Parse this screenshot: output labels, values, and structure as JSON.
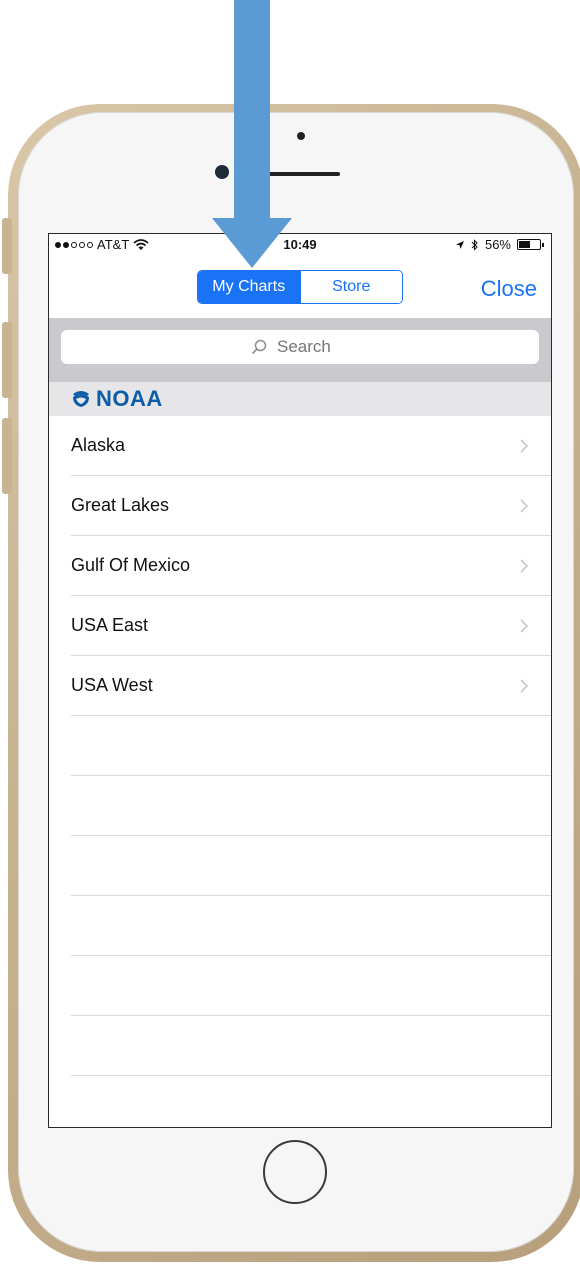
{
  "status_bar": {
    "carrier": "AT&T",
    "time": "10:49",
    "battery_percent": "56%",
    "battery_level": 0.56
  },
  "nav": {
    "segments": [
      "My Charts",
      "Store"
    ],
    "selected_segment": "My Charts",
    "close_label": "Close"
  },
  "search": {
    "placeholder": "Search"
  },
  "section": {
    "title": "NOAA"
  },
  "chart_regions": [
    "Alaska",
    "Great Lakes",
    "Gulf Of Mexico",
    "USA East",
    "USA West"
  ],
  "colors": {
    "accent": "#1a73f5",
    "noaa": "#0d5ca8",
    "arrow": "#5b9bd5",
    "search_bar_bg": "#c9c9ce",
    "section_bg": "#e6e6e8"
  },
  "icons": {
    "wifi": "wifi-icon",
    "location": "location-arrow-icon",
    "bluetooth": "bluetooth-icon",
    "battery": "battery-icon",
    "search": "search-icon",
    "noaa": "noaa-logo-icon",
    "chevron": "chevron-right-icon",
    "annotation": "down-arrow-icon"
  }
}
